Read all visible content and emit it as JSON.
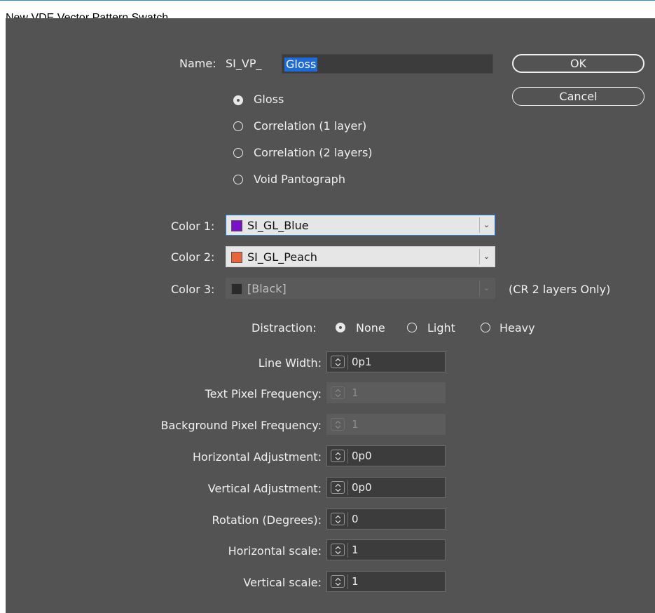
{
  "window": {
    "title": "New VDE Vector Pattern Swatch"
  },
  "name": {
    "label": "Name:",
    "prefix": "SI_VP_",
    "value": "Gloss"
  },
  "buttons": {
    "ok": "OK",
    "cancel": "Cancel"
  },
  "pattern_types": [
    {
      "label": "Gloss",
      "selected": true
    },
    {
      "label": "Correlation (1 layer)",
      "selected": false
    },
    {
      "label": "Correlation (2 layers)",
      "selected": false
    },
    {
      "label": "Void Pantograph",
      "selected": false
    }
  ],
  "colors": [
    {
      "label": "Color 1:",
      "value": "SI_GL_Blue",
      "swatch": "#7a10c8",
      "enabled": true
    },
    {
      "label": "Color 2:",
      "value": "SI_GL_Peach",
      "swatch": "#e8643c",
      "enabled": true
    },
    {
      "label": "Color 3:",
      "value": "[Black]",
      "swatch": "#2a2a2a",
      "enabled": false,
      "note": "(CR 2 layers Only)"
    }
  ],
  "distraction": {
    "label": "Distraction:",
    "options": [
      {
        "label": "None",
        "selected": true
      },
      {
        "label": "Light",
        "selected": false
      },
      {
        "label": "Heavy",
        "selected": false
      }
    ]
  },
  "fields": [
    {
      "label": "Line Width:",
      "value": "0p1",
      "enabled": true
    },
    {
      "label": "Text Pixel Frequency:",
      "value": "1",
      "enabled": false
    },
    {
      "label": "Background Pixel Frequency:",
      "value": "1",
      "enabled": false
    },
    {
      "label": "Horizontal Adjustment:",
      "value": "0p0",
      "enabled": true
    },
    {
      "label": "Vertical Adjustment:",
      "value": "0p0",
      "enabled": true
    },
    {
      "label": "Rotation (Degrees):",
      "value": "0",
      "enabled": true
    },
    {
      "label": "Horizontal scale:",
      "value": "1",
      "enabled": true
    },
    {
      "label": "Vertical scale:",
      "value": "1",
      "enabled": true
    }
  ],
  "icons": {
    "spinner": "up-down-stepper-icon",
    "dropdown": "chevron-down-icon",
    "radio": "radio-icon"
  },
  "theme": {
    "panel": "#535353",
    "accent": "#2b7fe0",
    "selection": "#1e6bd6"
  }
}
